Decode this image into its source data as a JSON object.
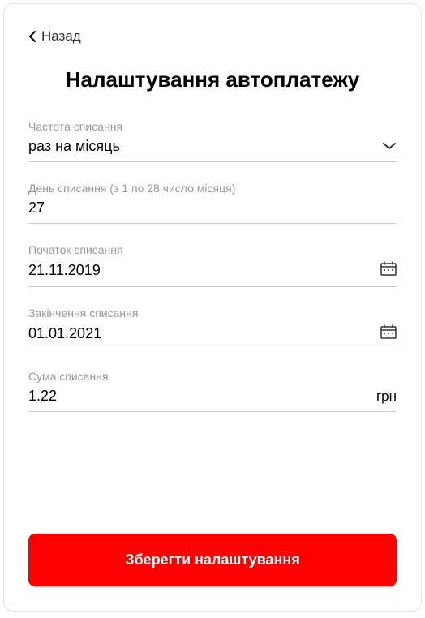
{
  "back": {
    "label": "Назад"
  },
  "title": "Налаштування автоплатежу",
  "fields": {
    "frequency": {
      "label": "Частота списання",
      "value": "раз на місяць"
    },
    "day": {
      "label": "День списання (з 1 по 28 число місяця)",
      "value": "27"
    },
    "start": {
      "label": "Початок списання",
      "value": "21.11.2019"
    },
    "end": {
      "label": "Закінчення списання",
      "value": "01.01.2021"
    },
    "amount": {
      "label": "Сума списання",
      "value": "1.22",
      "currency": "грн"
    }
  },
  "actions": {
    "save": "Зберегти налаштування"
  }
}
